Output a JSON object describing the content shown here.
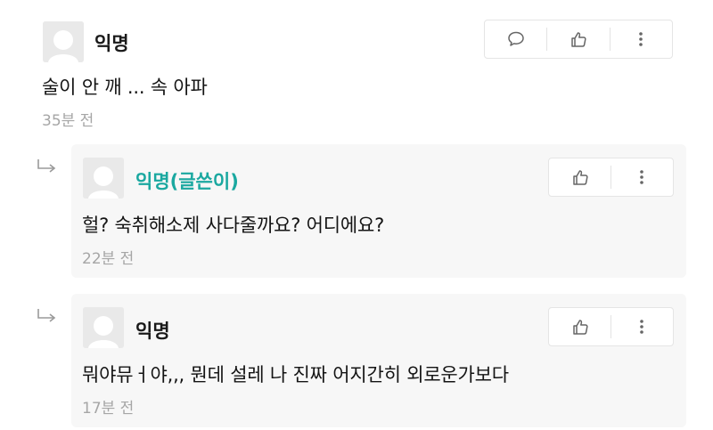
{
  "post": {
    "author": "익명",
    "text": "술이 안 깨 ... 속 아파",
    "time": "35분 전",
    "actions": [
      "comment-icon",
      "like-icon",
      "more-icon"
    ]
  },
  "replies": [
    {
      "author": "익명(글쓴이)",
      "is_op": true,
      "text": "헐? 숙취해소제 사다줄까요? 어디에요?",
      "time": "22분 전",
      "actions": [
        "like-icon",
        "more-icon"
      ]
    },
    {
      "author": "익명",
      "is_op": false,
      "text": "뭐야뮤ㅓ야,,, 뭔데 설레 나 진짜 어지간히 외로운가보다",
      "time": "17분 전",
      "actions": [
        "like-icon",
        "more-icon"
      ]
    }
  ],
  "colors": {
    "op_author": "#1aa8a0",
    "time": "#a6a6a6",
    "reply_bg": "#f7f7f7"
  }
}
